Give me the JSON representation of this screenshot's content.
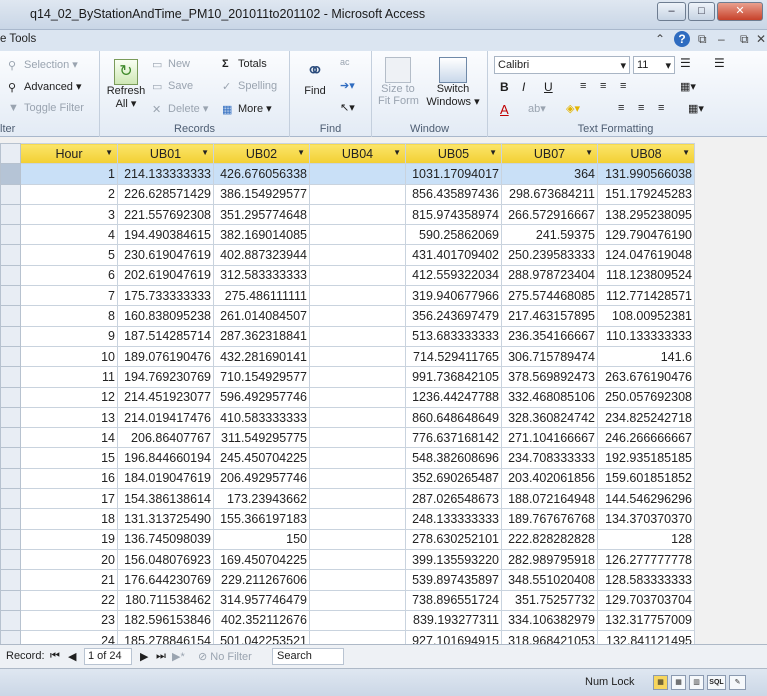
{
  "window": {
    "title": "q14_02_ByStationAndTime_PM10_201011to201102 - Microsoft Access",
    "minimize": "–",
    "maximize": "□",
    "close": "✕"
  },
  "tabbar": {
    "tools_label": "e Tools",
    "collapse": "⌃",
    "help": "?",
    "restore": "⧉",
    "close": "✕"
  },
  "ribbon": {
    "filter": {
      "selection": "Selection ▾",
      "advanced": "Advanced ▾",
      "toggle": "Toggle Filter",
      "label": "lter"
    },
    "records": {
      "refresh": "Refresh",
      "refresh_sub": "All ▾",
      "new": "New",
      "save": "Save",
      "delete": "Delete ▾",
      "totals": "Totals",
      "spelling": "Spelling",
      "more": "More ▾",
      "label": "Records"
    },
    "find": {
      "find": "Find",
      "label": "Find"
    },
    "window": {
      "size": "Size to",
      "size2": "Fit Form",
      "switch": "Switch",
      "switch2": "Windows ▾",
      "label": "Window"
    },
    "text": {
      "font": "Calibri",
      "size": "11",
      "bold": "B",
      "italic": "I",
      "underline": "U",
      "label": "Text Formatting"
    }
  },
  "table": {
    "columns": [
      "Hour",
      "UB01",
      "UB02",
      "UB04",
      "UB05",
      "UB07",
      "UB08"
    ],
    "rows": [
      [
        "1",
        "214.133333333",
        "426.676056338",
        "",
        "1031.17094017",
        "364",
        "131.990566038"
      ],
      [
        "2",
        "226.628571429",
        "386.154929577",
        "",
        "856.435897436",
        "298.673684211",
        "151.179245283"
      ],
      [
        "3",
        "221.557692308",
        "351.295774648",
        "",
        "815.974358974",
        "266.572916667",
        "138.295238095"
      ],
      [
        "4",
        "194.490384615",
        "382.169014085",
        "",
        "590.25862069",
        "241.59375",
        "129.790476190"
      ],
      [
        "5",
        "230.619047619",
        "402.887323944",
        "",
        "431.401709402",
        "250.239583333",
        "124.047619048"
      ],
      [
        "6",
        "202.619047619",
        "312.583333333",
        "",
        "412.559322034",
        "288.978723404",
        "118.123809524"
      ],
      [
        "7",
        "175.733333333",
        "275.486111111",
        "",
        "319.940677966",
        "275.574468085",
        "112.771428571"
      ],
      [
        "8",
        "160.838095238",
        "261.014084507",
        "",
        "356.243697479",
        "217.463157895",
        "108.00952381"
      ],
      [
        "9",
        "187.514285714",
        "287.362318841",
        "",
        "513.683333333",
        "236.354166667",
        "110.133333333"
      ],
      [
        "10",
        "189.076190476",
        "432.281690141",
        "",
        "714.529411765",
        "306.715789474",
        "141.6"
      ],
      [
        "11",
        "194.769230769",
        "710.154929577",
        "",
        "991.736842105",
        "378.569892473",
        "263.676190476"
      ],
      [
        "12",
        "214.451923077",
        "596.492957746",
        "",
        "1236.44247788",
        "332.468085106",
        "250.057692308"
      ],
      [
        "13",
        "214.019417476",
        "410.583333333",
        "",
        "860.648648649",
        "328.360824742",
        "234.825242718"
      ],
      [
        "14",
        "206.86407767",
        "311.549295775",
        "",
        "776.637168142",
        "271.104166667",
        "246.266666667"
      ],
      [
        "15",
        "196.844660194",
        "245.450704225",
        "",
        "548.382608696",
        "234.708333333",
        "192.935185185"
      ],
      [
        "16",
        "184.019047619",
        "206.492957746",
        "",
        "352.690265487",
        "203.402061856",
        "159.601851852"
      ],
      [
        "17",
        "154.386138614",
        "173.23943662",
        "",
        "287.026548673",
        "188.072164948",
        "144.546296296"
      ],
      [
        "18",
        "131.313725490",
        "155.366197183",
        "",
        "248.133333333",
        "189.767676768",
        "134.370370370"
      ],
      [
        "19",
        "136.745098039",
        "150",
        "",
        "278.630252101",
        "222.828282828",
        "128"
      ],
      [
        "20",
        "156.048076923",
        "169.450704225",
        "",
        "399.135593220",
        "282.989795918",
        "126.277777778"
      ],
      [
        "21",
        "176.644230769",
        "229.211267606",
        "",
        "539.897435897",
        "348.551020408",
        "128.583333333"
      ],
      [
        "22",
        "180.711538462",
        "314.957746479",
        "",
        "738.896551724",
        "351.75257732",
        "129.703703704"
      ],
      [
        "23",
        "182.596153846",
        "402.352112676",
        "",
        "839.193277311",
        "334.106382979",
        "132.317757009"
      ],
      [
        "24",
        "185.278846154",
        "501.042253521",
        "",
        "927.101694915",
        "318.968421053",
        "132.841121495"
      ]
    ]
  },
  "statusbar": {
    "record_label": "Record:",
    "first": "⏮",
    "prev": "◀",
    "position": "1 of 24",
    "next": "▶",
    "last": "⏭",
    "new": "▶*",
    "no_filter": "No Filter",
    "search": "Search"
  },
  "footer": {
    "num_lock": "Num Lock",
    "sql": "SQL"
  }
}
